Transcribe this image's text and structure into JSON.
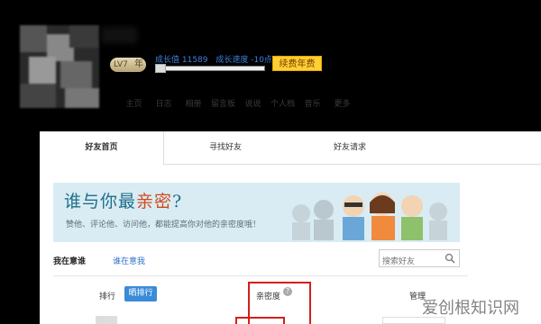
{
  "profile": {
    "level_badge": "LV7",
    "level_suffix": "年",
    "growth_value": "成长值 11589",
    "growth_speed": "成长速度 -10点/天",
    "renew_button": "续费年费",
    "progress": 0.05
  },
  "top_nav": [
    "主页",
    "日志",
    "相册",
    "留言板",
    "说说",
    "个人档",
    "音乐",
    "更多"
  ],
  "tabs": [
    {
      "label": "好友首页",
      "active": true
    },
    {
      "label": "寻找好友",
      "active": false
    },
    {
      "label": "好友请求",
      "active": false
    }
  ],
  "banner": {
    "question_prefix": "谁与你最",
    "question_highlight": "亲密",
    "question_suffix": "?",
    "subtitle": "赞他、评论他、访问他，都能提高你对他的亲密度哦！"
  },
  "filters": {
    "i_care": "我在意谁",
    "cares_me": "谁在意我"
  },
  "search": {
    "placeholder": "搜索好友"
  },
  "table_header": {
    "rank": "排行",
    "rank_button": "晒排行",
    "intimacy": "亲密度",
    "help": "?",
    "manage": "管理"
  },
  "watermark": "爱创根知识网",
  "colors": {
    "accent": "#3b8bd9",
    "highlight_box": "#d21f1f",
    "renew": "#ffcf33"
  }
}
